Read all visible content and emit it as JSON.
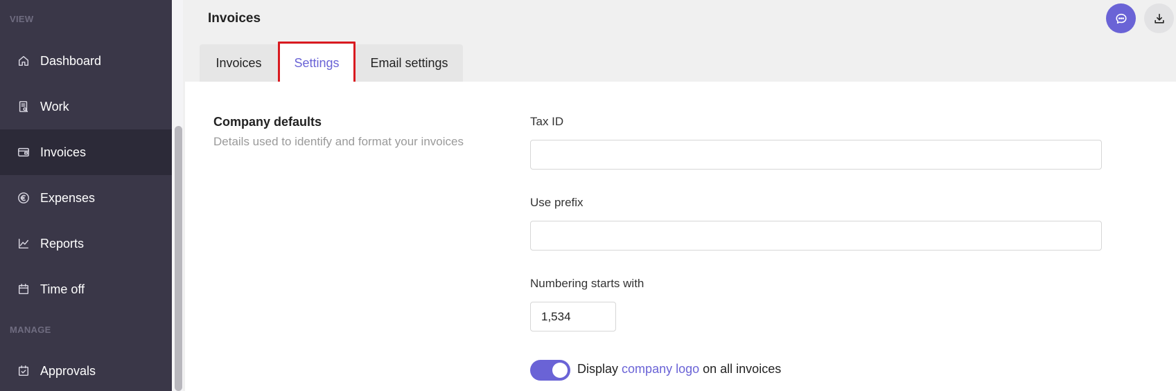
{
  "sidebar": {
    "sections": {
      "view": "VIEW",
      "manage": "MANAGE"
    },
    "items": [
      {
        "label": "Dashboard",
        "icon": "home-icon"
      },
      {
        "label": "Work",
        "icon": "clipboard-icon"
      },
      {
        "label": "Invoices",
        "icon": "wallet-icon",
        "active": true
      },
      {
        "label": "Expenses",
        "icon": "euro-circle-icon"
      },
      {
        "label": "Reports",
        "icon": "line-chart-icon"
      },
      {
        "label": "Time off",
        "icon": "calendar-icon"
      },
      {
        "label": "Approvals",
        "icon": "calendar-check-icon"
      }
    ]
  },
  "header": {
    "title": "Invoices",
    "tabs": [
      {
        "label": "Invoices"
      },
      {
        "label": "Settings",
        "active": true
      },
      {
        "label": "Email settings"
      }
    ],
    "actions": {
      "chat_icon": "chat-bubble-icon",
      "download_icon": "download-icon"
    }
  },
  "main": {
    "section_title": "Company defaults",
    "section_description": "Details used to identify and format your invoices",
    "fields": {
      "tax_id": {
        "label": "Tax ID",
        "value": ""
      },
      "use_prefix": {
        "label": "Use prefix",
        "value": ""
      },
      "numbering": {
        "label": "Numbering starts with",
        "value": "1,534"
      }
    },
    "logo_toggle": {
      "on": true,
      "text_before": "Display",
      "link": "company logo",
      "text_after": "on all invoices"
    }
  },
  "colors": {
    "sidebar_bg": "#3a3748",
    "sidebar_active_bg": "#2c2a38",
    "accent": "#6a63d6",
    "highlight_border": "#d91a20"
  }
}
